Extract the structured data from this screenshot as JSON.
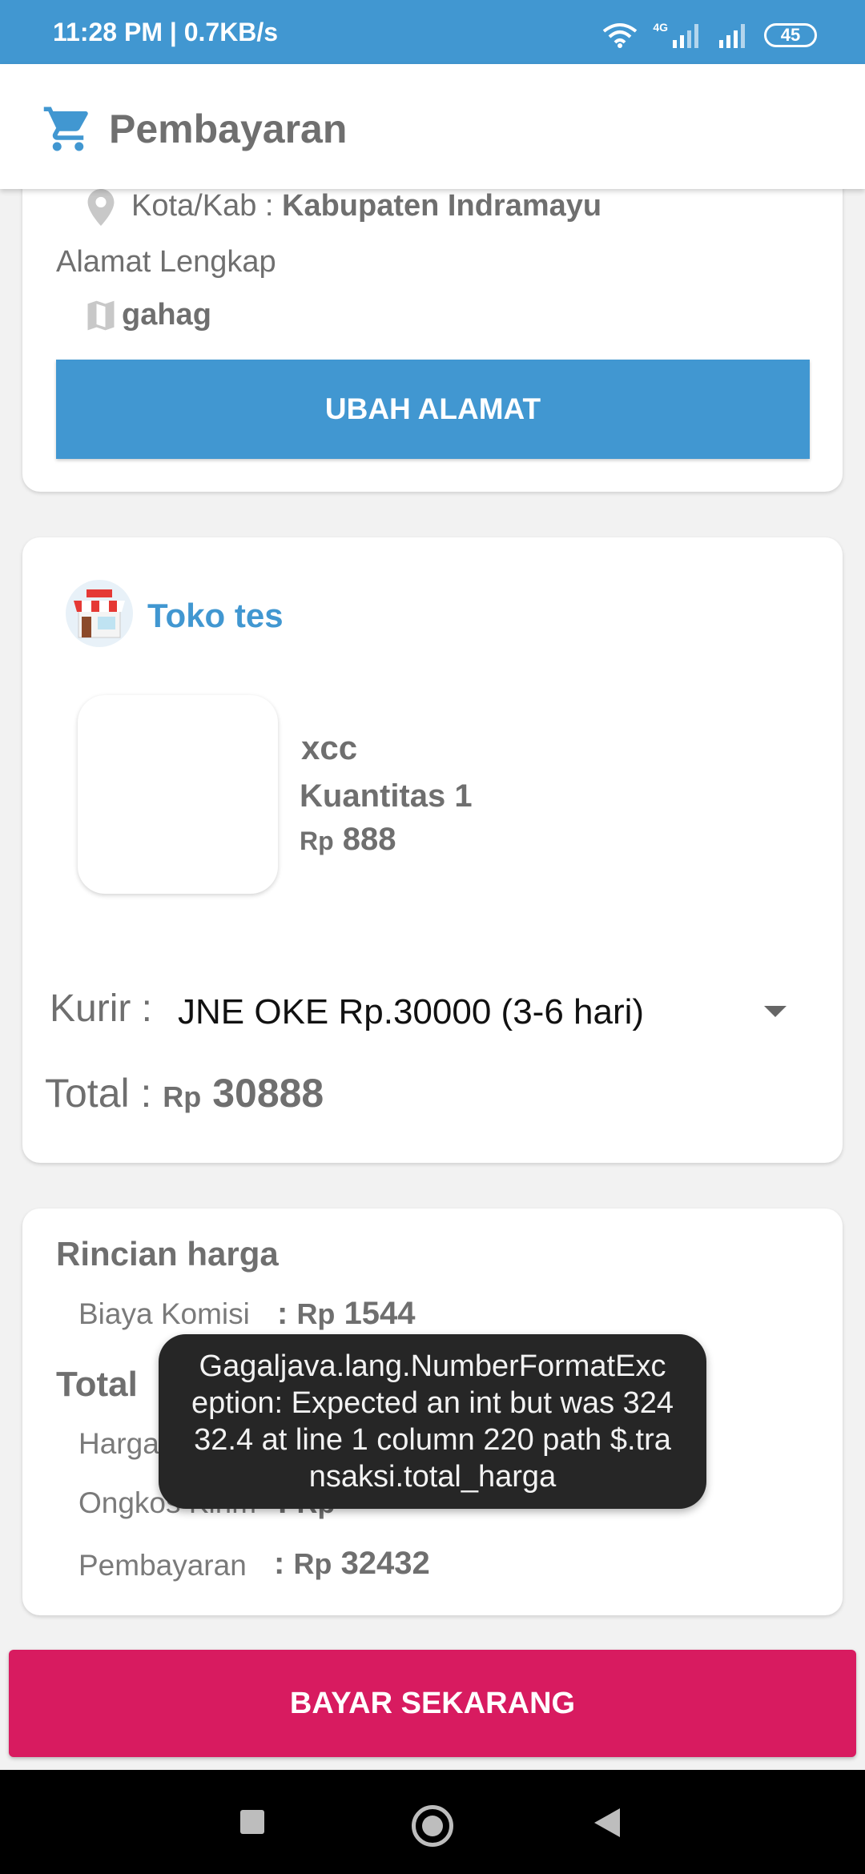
{
  "status_bar": {
    "time": "11:28 PM | 0.7KB/s",
    "network": "4G",
    "battery": "45"
  },
  "app_bar": {
    "title": "Pembayaran",
    "icon": "cart-icon"
  },
  "address": {
    "kota_label": "Kota/Kab : ",
    "kota_value": "Kabupaten Indramayu",
    "alamat_label": "Alamat Lengkap",
    "alamat_value": "gahag",
    "change_button": "UBAH ALAMAT"
  },
  "store": {
    "name": "Toko tes",
    "product": {
      "name": "xcc",
      "quantity": "Kuantitas 1",
      "currency": "Rp",
      "price": "888"
    },
    "kurir_label": "Kurir :",
    "kurir_value": "JNE OKE Rp.30000 (3-6 hari)",
    "total_label": "Total : ",
    "total_currency": "Rp",
    "total_value": "30888"
  },
  "price_details": {
    "title": "Rincian harga",
    "komisi_label": "Biaya Komisi",
    "komisi_value": "1544",
    "total_title": "Total",
    "harga_label": "Harga",
    "ongkos_label": "Ongkos Kirim",
    "pembayaran_label": "Pembayaran",
    "pembayaran_value": "32432",
    "colon": ": ",
    "currency": "Rp"
  },
  "toast": {
    "message": "Gagaljava.lang.NumberFormatException: Expected an int but was 32432.4 at line 1 column 220 path $.transaksi.total_harga"
  },
  "pay_button": "BAYAR SEKARANG",
  "colors": {
    "primary": "#4197d1",
    "accent": "#d81b60"
  }
}
